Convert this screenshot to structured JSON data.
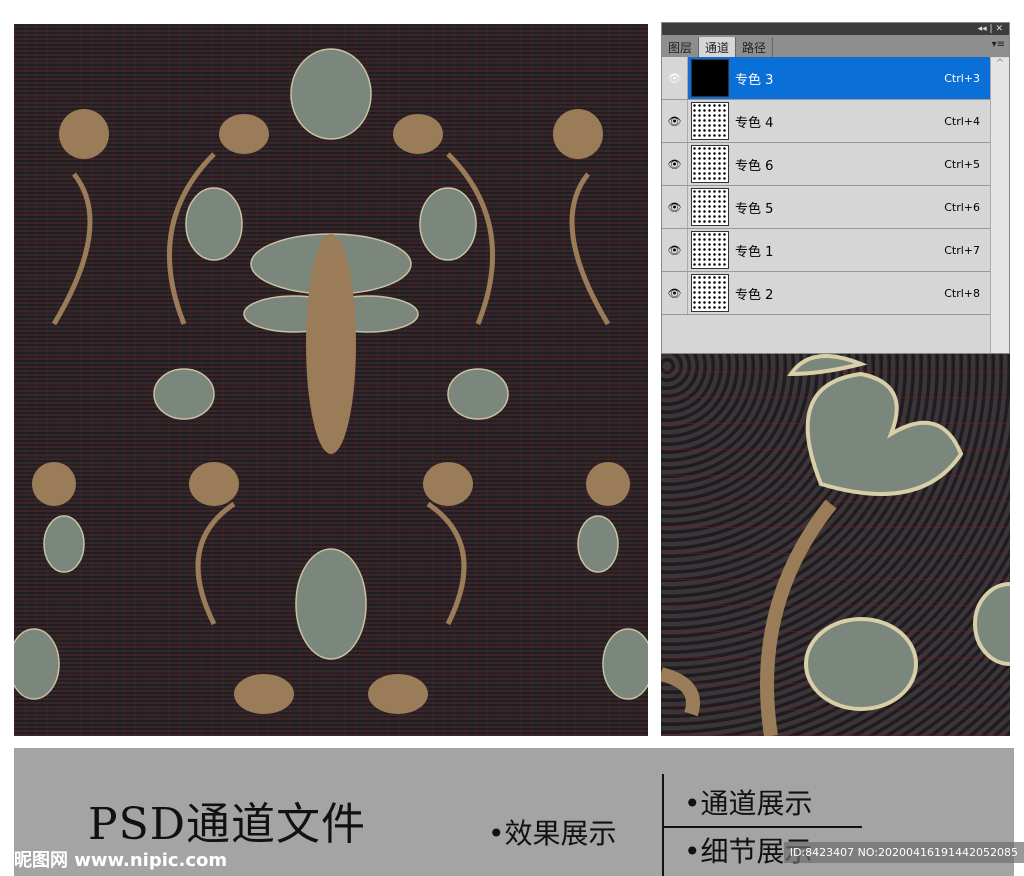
{
  "panel": {
    "controls": "◂◂ | ✕",
    "tabs": [
      "图层",
      "通道",
      "路径"
    ],
    "menu_icon": "▾≡",
    "channels": [
      {
        "name": "专色 3",
        "shortcut": "Ctrl+3",
        "selected": true
      },
      {
        "name": "专色 4",
        "shortcut": "Ctrl+4"
      },
      {
        "name": "专色 6",
        "shortcut": "Ctrl+5"
      },
      {
        "name": "专色 5",
        "shortcut": "Ctrl+6"
      },
      {
        "name": "专色 1",
        "shortcut": "Ctrl+7"
      },
      {
        "name": "专色 2",
        "shortcut": "Ctrl+8"
      }
    ],
    "eye": "👁",
    "scroll_up": "^"
  },
  "band": {
    "title": "PSD通道文件",
    "effect": "•效果展示",
    "channel": "•通道展示",
    "detail": "•细节展示",
    "logo": "昵图网 www.nipic.com",
    "id": "ID:8423407 NO:20200416191442052085"
  },
  "colors": {
    "sage": "#7b877c",
    "tan": "#9a7c58",
    "bg": "#2b2528",
    "select": "#0a6fd6"
  }
}
